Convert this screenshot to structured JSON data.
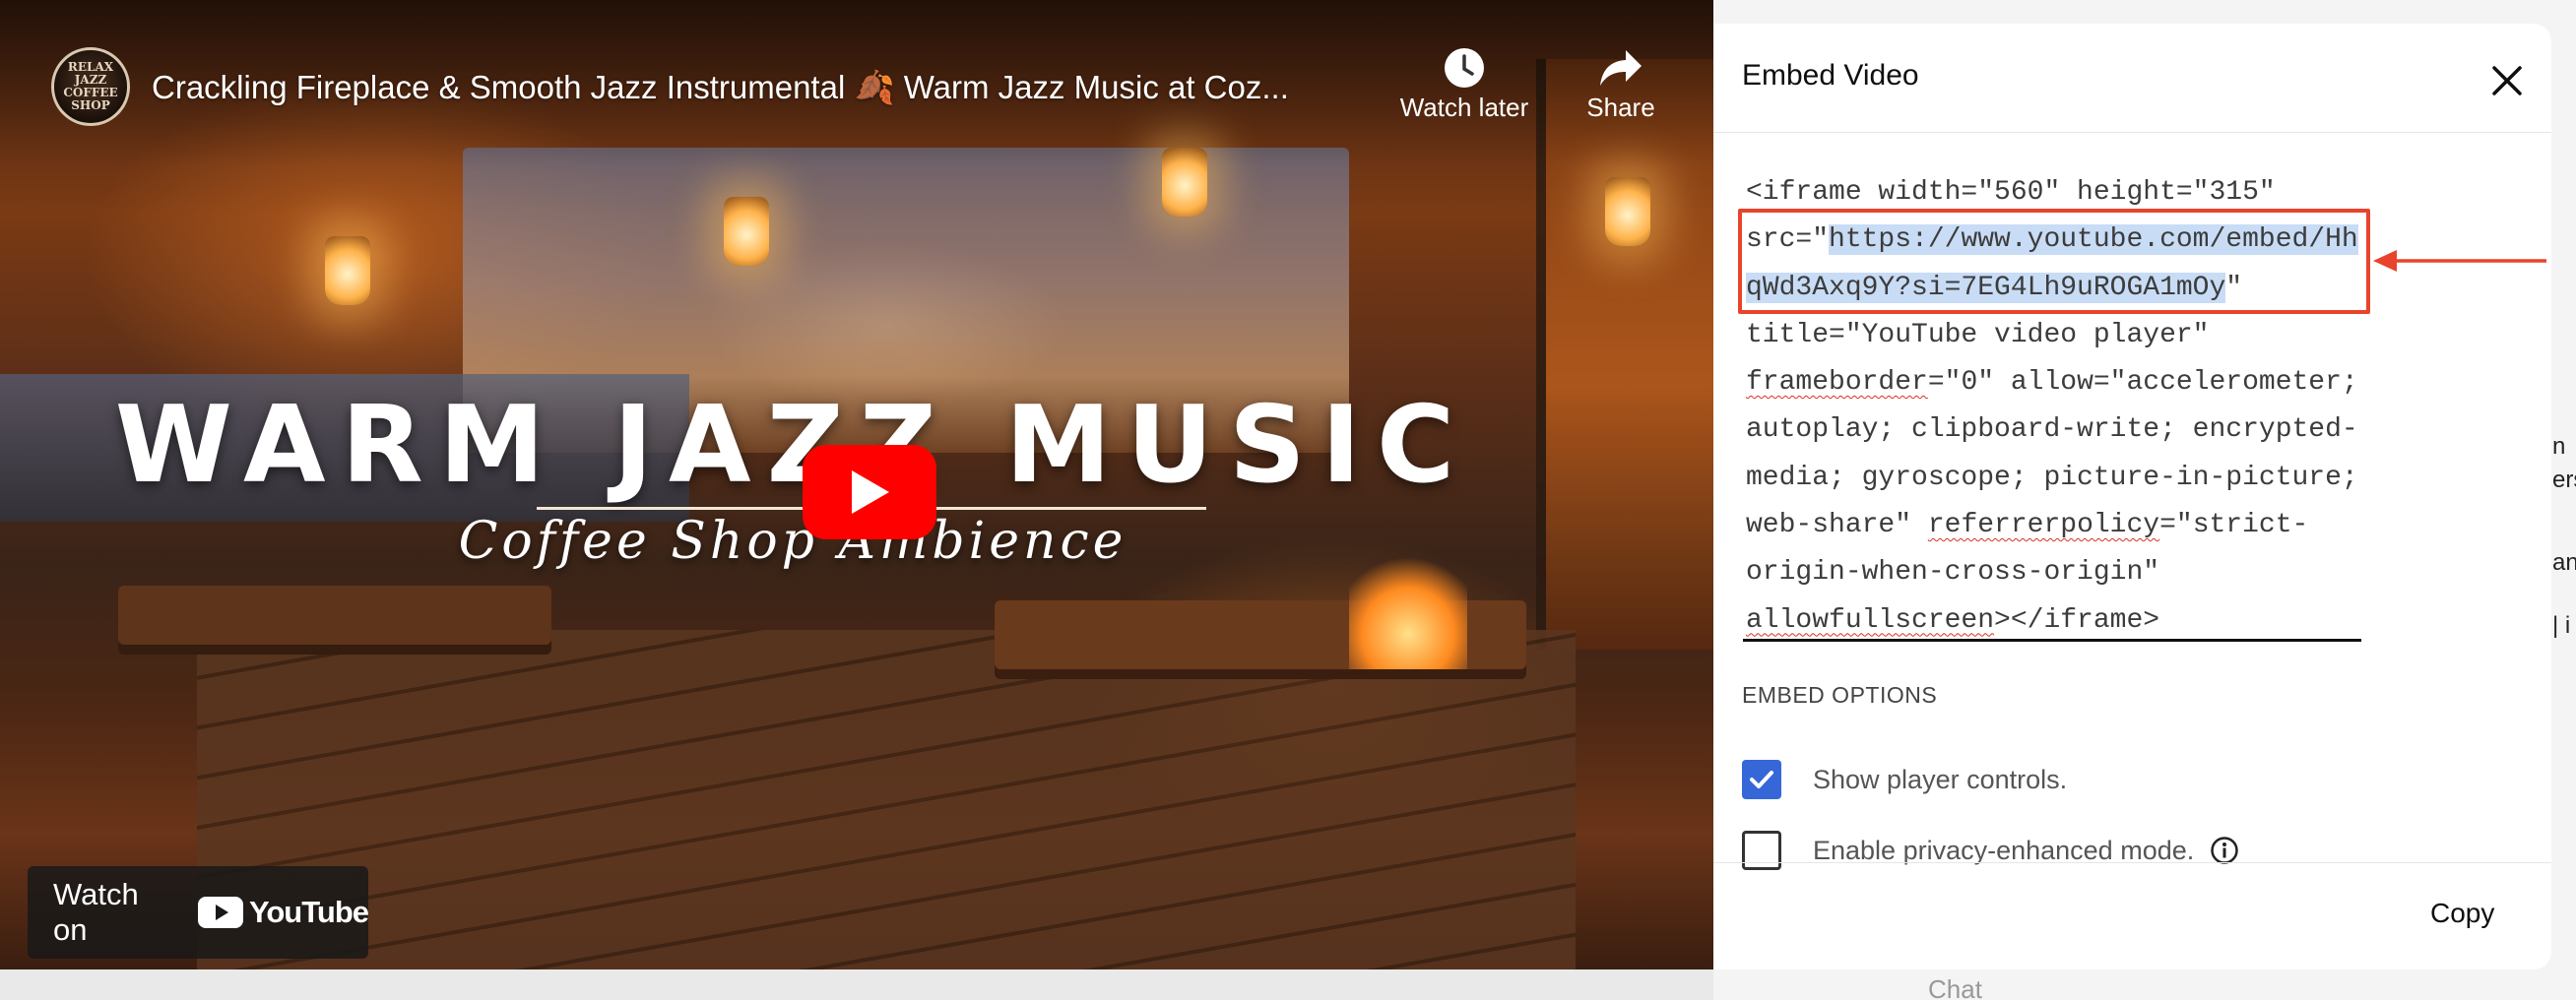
{
  "player": {
    "title": "Crackling Fireplace & Smooth Jazz Instrumental 🍂 Warm Jazz Music at Coz...",
    "channel_logo_text": "RELAX JAZZ COFFEE SHOP",
    "actions": [
      {
        "label": "Watch later",
        "icon": "clock-icon"
      },
      {
        "label": "Share",
        "icon": "share-arrow-icon"
      }
    ],
    "overlay_title": "WARM JAZZ MUSIC",
    "overlay_subtitle": "Coffee Shop Ambience",
    "watch_on_label": "Watch on",
    "youtube_wordmark": "YouTube"
  },
  "dialog": {
    "title": "Embed Video",
    "code_lines": [
      {
        "text": "<iframe width=\"560\" height=\"315\""
      },
      {
        "prefix": "src=\"",
        "selected": "https://www.youtube.com/embed/Hh"
      },
      {
        "selected": "qWd3Axq9Y?si=7EG4Lh9uROGA1mOy",
        "suffix": "\""
      },
      {
        "text": "title=\"YouTube video player\""
      },
      {
        "spell": "frameborder",
        "rest": "=\"0\" allow=\"accelerometer;"
      },
      {
        "text": "autoplay; clipboard-write; encrypted-"
      },
      {
        "text": "media; gyroscope; picture-in-picture;"
      },
      {
        "pre": "web-share\" ",
        "spell": "referrerpolicy",
        "rest": "=\"strict-"
      },
      {
        "text": "origin-when-cross-origin\""
      },
      {
        "spell": "allowfullscreen",
        "rest": "></iframe>"
      }
    ],
    "embed_options_heading": "EMBED OPTIONS",
    "options": [
      {
        "label": "Show player controls.",
        "checked": true
      },
      {
        "label": "Enable privacy-enhanced mode.",
        "checked": false
      }
    ],
    "copy_label": "Copy"
  },
  "background_page": {
    "chat_placeholder": "Chat",
    "fragments": [
      "n",
      "ers",
      "and",
      "| i"
    ]
  },
  "colors": {
    "annotation": "#e8442c",
    "selection": "#c8dcf6",
    "checkbox": "#3567d8",
    "play_button": "#ff0000"
  }
}
